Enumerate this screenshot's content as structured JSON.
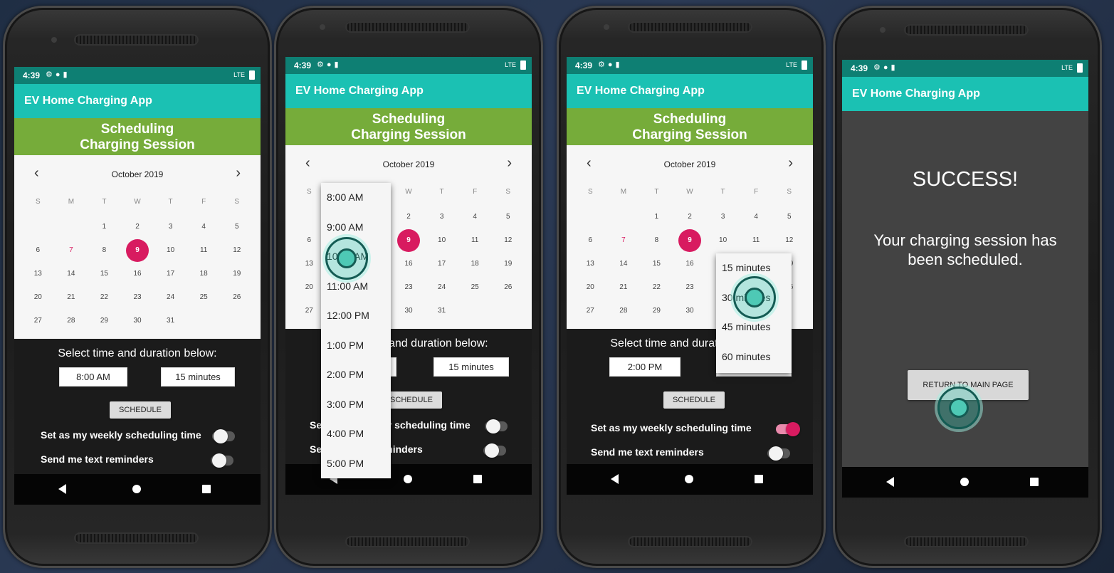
{
  "status": {
    "time": "4:39",
    "network": "LTE"
  },
  "app_title": "EV Home Charging App",
  "banner": {
    "line1": "Scheduling",
    "line2": "Charging Session"
  },
  "calendar": {
    "month": "October 2019",
    "dow": [
      "S",
      "M",
      "T",
      "W",
      "T",
      "F",
      "S"
    ],
    "weeks": [
      [
        "",
        "",
        "1",
        "2",
        "3",
        "4",
        "5"
      ],
      [
        "6",
        "7",
        "8",
        "9",
        "10",
        "11",
        "12"
      ],
      [
        "13",
        "14",
        "15",
        "16",
        "17",
        "18",
        "19"
      ],
      [
        "20",
        "21",
        "22",
        "23",
        "24",
        "25",
        "26"
      ],
      [
        "27",
        "28",
        "29",
        "30",
        "31",
        "",
        ""
      ]
    ],
    "today": "7",
    "selected": "9"
  },
  "controls": {
    "label": "Select time and duration below:",
    "schedule_label": "SCHEDULE",
    "weekly_label": "Set as my weekly scheduling time",
    "reminders_label": "Send me text reminders"
  },
  "screens": [
    {
      "time_value": "8:00 AM",
      "duration_value": "15 minutes",
      "weekly_on": false,
      "reminders_on": false
    },
    {
      "time_value": "",
      "duration_value": "15 minutes",
      "weekly_on": false,
      "reminders_on": false
    },
    {
      "time_value": "2:00 PM",
      "duration_value": "15 minutes",
      "weekly_on": true,
      "reminders_on": false
    }
  ],
  "time_options": [
    "8:00 AM",
    "9:00 AM",
    "10:00 AM",
    "11:00 AM",
    "12:00 PM",
    "1:00 PM",
    "2:00 PM",
    "3:00 PM",
    "4:00 PM",
    "5:00 PM"
  ],
  "duration_options": [
    "15 minutes",
    "30 minutes",
    "45 minutes",
    "60 minutes"
  ],
  "success": {
    "title": "SUCCESS!",
    "message": "Your charging session has been scheduled.",
    "button": "RETURN TO MAIN PAGE"
  }
}
